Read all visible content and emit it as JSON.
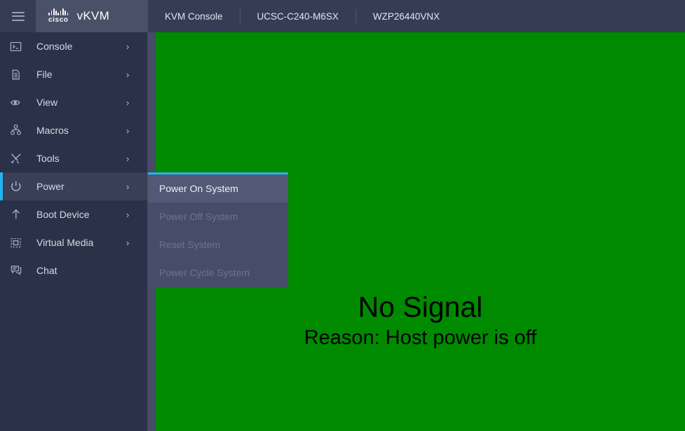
{
  "topbar": {
    "hamburger_icon": "hamburger-menu-icon",
    "brand": {
      "logo_icon": "cisco-logo-icon",
      "logo_word": "cisco",
      "title": "vKVM"
    },
    "tabs": [
      {
        "label": "KVM Console"
      },
      {
        "label": "UCSC-C240-M6SX"
      },
      {
        "label": "WZP26440VNX"
      }
    ]
  },
  "sidebar": {
    "items": [
      {
        "label": "Console",
        "icon": "terminal-icon",
        "arrow": "›",
        "has_submenu": true,
        "active": false
      },
      {
        "label": "File",
        "icon": "file-icon",
        "arrow": "›",
        "has_submenu": true,
        "active": false
      },
      {
        "label": "View",
        "icon": "eye-icon",
        "arrow": "›",
        "has_submenu": true,
        "active": false
      },
      {
        "label": "Macros",
        "icon": "hierarchy-icon",
        "arrow": "›",
        "has_submenu": true,
        "active": false
      },
      {
        "label": "Tools",
        "icon": "tools-icon",
        "arrow": "›",
        "has_submenu": true,
        "active": false
      },
      {
        "label": "Power",
        "icon": "power-icon",
        "arrow": "›",
        "has_submenu": true,
        "active": true
      },
      {
        "label": "Boot Device",
        "icon": "arrow-up-icon",
        "arrow": "›",
        "has_submenu": true,
        "active": false
      },
      {
        "label": "Virtual Media",
        "icon": "virtual-media-icon",
        "arrow": "›",
        "has_submenu": true,
        "active": false
      },
      {
        "label": "Chat",
        "icon": "chat-icon",
        "arrow": "",
        "has_submenu": false,
        "active": false
      }
    ]
  },
  "submenu": {
    "parent": "Power",
    "items": [
      {
        "label": "Power On System",
        "disabled": false,
        "highlighted": true
      },
      {
        "label": "Power Off System",
        "disabled": true,
        "highlighted": false
      },
      {
        "label": "Reset System",
        "disabled": true,
        "highlighted": false
      },
      {
        "label": "Power Cycle System",
        "disabled": true,
        "highlighted": false
      }
    ]
  },
  "screen": {
    "background_color": "#008a00",
    "title": "No Signal",
    "reason": "Reason: Host power is off"
  },
  "colors": {
    "accent": "#21b5ee",
    "topbar_bg": "#353c54",
    "brand_bg": "#4a5068",
    "sidebar_bg": "#2b3148",
    "sidebar_active_bg": "#383f57",
    "submenu_bg": "#474d68",
    "submenu_highlight_bg": "#525876",
    "screen_green": "#008a00",
    "disabled_text": "#6d738b"
  }
}
